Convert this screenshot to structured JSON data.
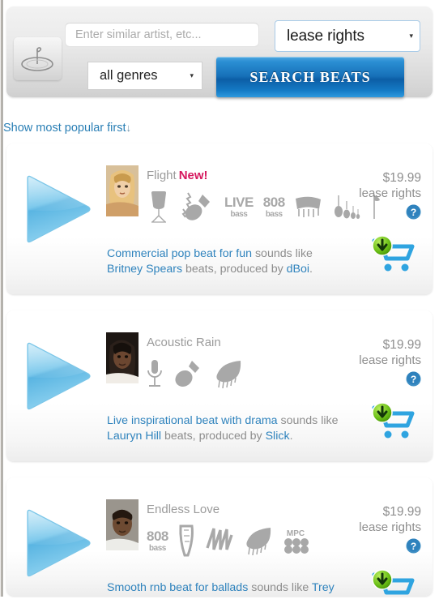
{
  "header": {
    "logo_alt": "beat-logo",
    "search_input": {
      "value": "",
      "placeholder": "Enter similar artist, etc..."
    },
    "rights_select": {
      "selected": "lease rights",
      "caret": "▾"
    },
    "genre_select": {
      "selected": "all genres",
      "caret": "▾"
    },
    "search_button": "SEARCH BEATS"
  },
  "sort": {
    "label": "Show most popular first",
    "arrow": "↓"
  },
  "colors": {
    "accent_blue": "#2f83bd",
    "button_blue": "#1670b8",
    "new_badge": "#d6185e",
    "muted_text": "#8d8d8d",
    "icon_gray": "#a8a8a8",
    "panel_gray": "#e4e4e4"
  },
  "beats": [
    {
      "title": "Flight",
      "badge": "New!",
      "thumb_name": "artist-thumb-flight",
      "instruments": [
        "drum-kit-icon",
        "electric-guitar-icon",
        "live-bass-icon",
        "808-bass-icon",
        "marimba-icon",
        "cello-section-icon",
        "flag-icon"
      ],
      "instrument_text": [
        {
          "big": "LIVE",
          "small": "bass"
        },
        {
          "big": "808",
          "small": "bass"
        }
      ],
      "desc_link1": "Commercial pop beat for fun",
      "desc_mid1": " sounds like ",
      "desc_link2": "Britney Spears",
      "desc_mid2": " beats, produced by ",
      "desc_link3": "dBoi",
      "desc_end": ".",
      "price": "$19.99",
      "rights": "lease rights",
      "help": "?",
      "cart_name": "add-to-cart"
    },
    {
      "title": "Acoustic Rain",
      "badge": "",
      "thumb_name": "artist-thumb-acoustic-rain",
      "instruments": [
        "microphone-icon",
        "guitar-icon",
        "grand-piano-icon"
      ],
      "instrument_text": [],
      "desc_link1": "Live inspirational beat with drama",
      "desc_mid1": " sounds like ",
      "desc_link2": "Lauryn Hill",
      "desc_mid2": " beats, produced by ",
      "desc_link3": "Slick",
      "desc_end": ".",
      "price": "$19.99",
      "rights": "lease rights",
      "help": "?",
      "cart_name": "add-to-cart"
    },
    {
      "title": "Endless Love",
      "badge": "",
      "thumb_name": "artist-thumb-endless-love",
      "instruments": [
        "808-bass-icon",
        "harp-icon",
        "synth-wave-icon",
        "grand-piano-icon",
        "mpc-icon"
      ],
      "instrument_text": [
        {
          "big": "808",
          "small": "bass"
        }
      ],
      "desc_link1": "Smooth rnb beat for ballads",
      "desc_mid1": " sounds like ",
      "desc_link2": "Trey",
      "desc_mid2": "",
      "desc_link3": "",
      "desc_end": "",
      "price": "$19.99",
      "rights": "lease rights",
      "help": "?",
      "cart_name": "add-to-cart"
    }
  ]
}
